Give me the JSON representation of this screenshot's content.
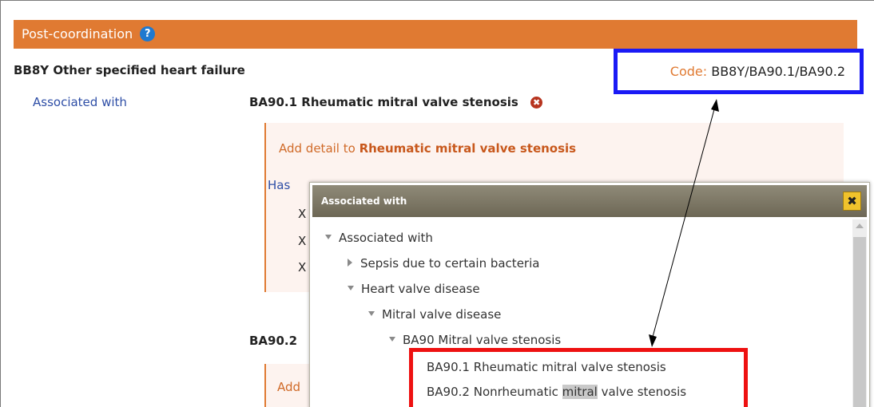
{
  "header": {
    "title": "Post-coordination",
    "help_glyph": "?"
  },
  "entity": {
    "title": "BB8Y Other specified heart failure"
  },
  "code": {
    "label": "Code: ",
    "value": "BB8Y/BA90.1/BA90.2"
  },
  "association": {
    "label": "Associated with",
    "entity": "BA90.1 Rheumatic mitral valve stenosis",
    "remove_glyph": "✖"
  },
  "detail": {
    "prefix": "Add detail to ",
    "target": "Rheumatic mitral valve stenosis",
    "has_label": "Has",
    "x_marks": [
      "X",
      "X",
      "X"
    ]
  },
  "second": {
    "label": "BA90.2",
    "add_label": "Add"
  },
  "dialog": {
    "title": "Associated with",
    "close_glyph": "✖",
    "tree": [
      {
        "label": "Associated with",
        "state": "expanded"
      },
      {
        "label": "Sepsis due to certain bacteria",
        "state": "collapsed"
      },
      {
        "label": "Heart valve disease",
        "state": "expanded"
      },
      {
        "label": "Mitral valve disease",
        "state": "expanded"
      },
      {
        "label": "BA90 Mitral valve stenosis",
        "state": "expanded"
      },
      {
        "label": "BA90.1 Rheumatic mitral valve stenosis",
        "state": "leaf"
      },
      {
        "label_before": "BA90.2 Nonrheumatic ",
        "label_highlight": "mitral",
        "label_after": " valve stenosis",
        "state": "leaf"
      }
    ]
  },
  "colors": {
    "header_orange": "#e07a32",
    "code_box_blue": "#1a1af5",
    "results_box_red": "#ee1111",
    "link_blue": "#2e4ea6"
  }
}
